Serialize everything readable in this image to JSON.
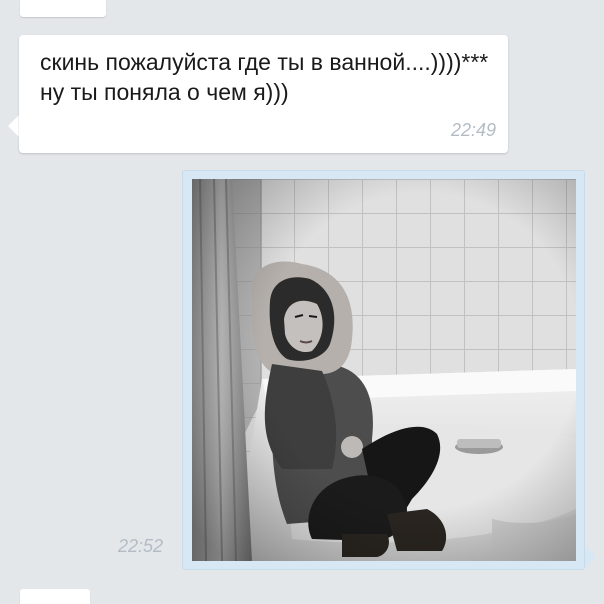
{
  "messages": {
    "incoming": {
      "text": "скинь пожалуйста где ты в ванной....))))*** ну ты поняла о чем я)))",
      "time": "22:49"
    },
    "outgoing": {
      "time": "22:52",
      "photo_icon": "photo-image",
      "photo_filter": "grayscale"
    }
  },
  "colors": {
    "background": "#e3e7ea",
    "incoming_bubble": "#ffffff",
    "outgoing_bubble": "#d7e7f4",
    "timestamp": "#b3bcc4"
  }
}
